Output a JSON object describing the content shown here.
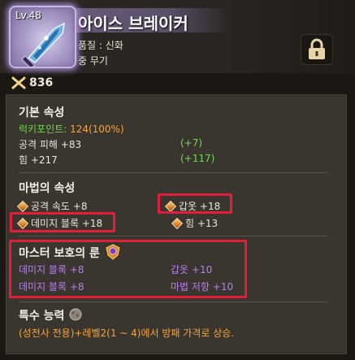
{
  "item": {
    "level": "Lv.48",
    "name": "아이스 브레이커",
    "quality": "품질 : 신화",
    "kind": "중 무기",
    "cost": "836"
  },
  "basic": {
    "title": "기본 속성",
    "luck": {
      "label": "럭키포인트: ",
      "value": "124(100%)"
    },
    "rows": [
      {
        "label": "공격 피해 +83",
        "bonus": "(+7)"
      },
      {
        "label": "힘 +217",
        "bonus": "(+117)"
      }
    ]
  },
  "magic": {
    "title": "마법의 속성",
    "left": [
      "공격 속도 +8",
      "데미지 블록 +18"
    ],
    "right": [
      "갑옷 +18",
      "힘 +13"
    ]
  },
  "rune": {
    "title": "마스터 보호의 룬",
    "left": [
      "데미지 블록 +8",
      "데미지 블록 +8"
    ],
    "right": [
      "갑옷 +10",
      "마법 저항 +10"
    ]
  },
  "special": {
    "title": "특수 능력",
    "text": "(성전사 전용)+레벨2(1 ~ 4)에서 방패 가격로 상승."
  },
  "colors": {
    "highlight": "#e21f3b",
    "green": "#6ed94e",
    "orange": "#f2a53a",
    "purple": "#b77ef0"
  },
  "icons": [
    "sword-item-icon",
    "lock-icon",
    "crossed-swords-cost-icon",
    "orange-gem-icon",
    "rune-shield-icon",
    "rock-fist-icon"
  ]
}
